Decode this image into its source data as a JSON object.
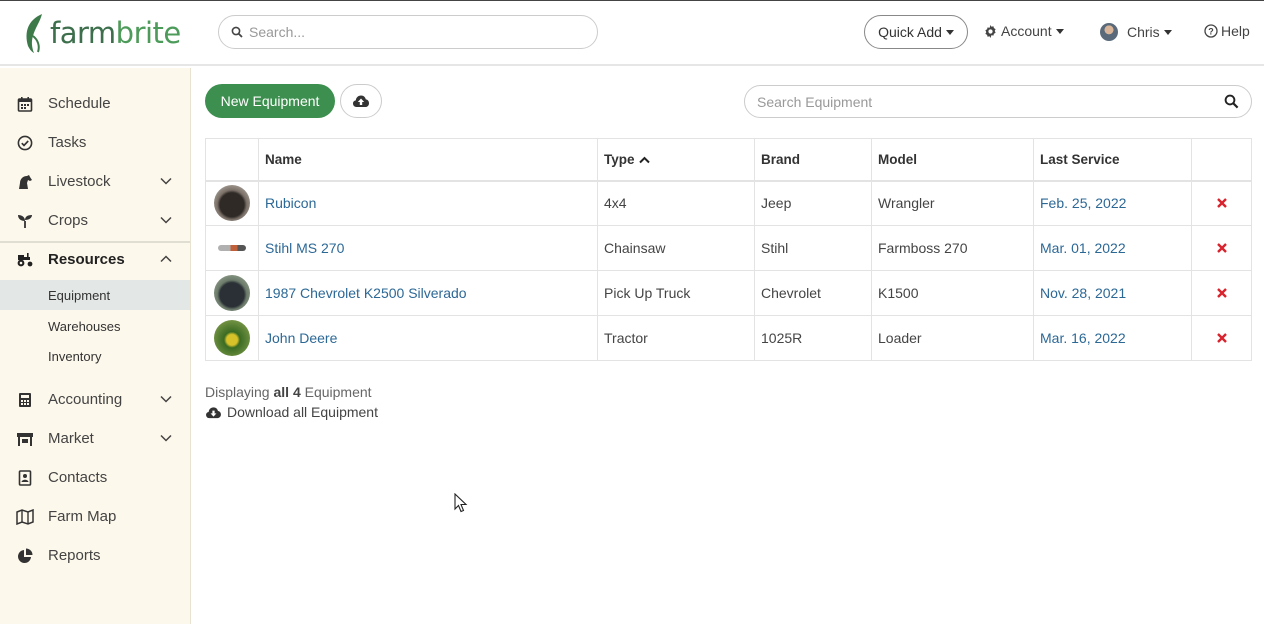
{
  "header": {
    "logo_farm": "farm",
    "logo_brite": "brite",
    "search_placeholder": "Search...",
    "quick_add": "Quick Add",
    "account": "Account",
    "user": "Chris",
    "help": "Help"
  },
  "sidebar": {
    "items": [
      {
        "label": "Schedule",
        "icon": "calendar-icon"
      },
      {
        "label": "Tasks",
        "icon": "check-circle-icon"
      },
      {
        "label": "Livestock",
        "icon": "horse-icon",
        "expandable": true
      },
      {
        "label": "Crops",
        "icon": "seedling-icon",
        "expandable": true
      },
      {
        "label": "Resources",
        "icon": "tractor-icon",
        "expanded": true
      },
      {
        "label": "Accounting",
        "icon": "calculator-icon",
        "expandable": true
      },
      {
        "label": "Market",
        "icon": "store-icon",
        "expandable": true
      },
      {
        "label": "Contacts",
        "icon": "address-book-icon"
      },
      {
        "label": "Farm Map",
        "icon": "map-icon"
      },
      {
        "label": "Reports",
        "icon": "pie-chart-icon"
      }
    ],
    "subitems": [
      {
        "label": "Equipment",
        "selected": true
      },
      {
        "label": "Warehouses"
      },
      {
        "label": "Inventory"
      }
    ]
  },
  "main": {
    "new_button": "New Equipment",
    "search_placeholder": "Search Equipment",
    "columns": [
      "Name",
      "Type",
      "Brand",
      "Model",
      "Last Service"
    ],
    "sorted_column": "Type",
    "rows": [
      {
        "name": "Rubicon",
        "type": "4x4",
        "brand": "Jeep",
        "model": "Wrangler",
        "last_service": "Feb. 25, 2022"
      },
      {
        "name": "Stihl MS 270",
        "type": "Chainsaw",
        "brand": "Stihl",
        "model": "Farmboss 270",
        "last_service": "Mar. 01, 2022"
      },
      {
        "name": "1987 Chevrolet K2500 Silverado",
        "type": "Pick Up Truck",
        "brand": "Chevrolet",
        "model": "K1500",
        "last_service": "Nov. 28, 2021"
      },
      {
        "name": "John Deere",
        "type": "Tractor",
        "brand": "1025R",
        "model": "Loader",
        "last_service": "Mar. 16, 2022"
      }
    ],
    "display_prefix": "Displaying",
    "display_all": "all 4",
    "display_suffix": "Equipment",
    "download_label": "Download all Equipment"
  },
  "colors": {
    "brand_green": "#3c8f4e",
    "link_blue": "#2c6896",
    "delete_red": "#d9232e",
    "sidebar_bg": "#fdf8ec"
  }
}
